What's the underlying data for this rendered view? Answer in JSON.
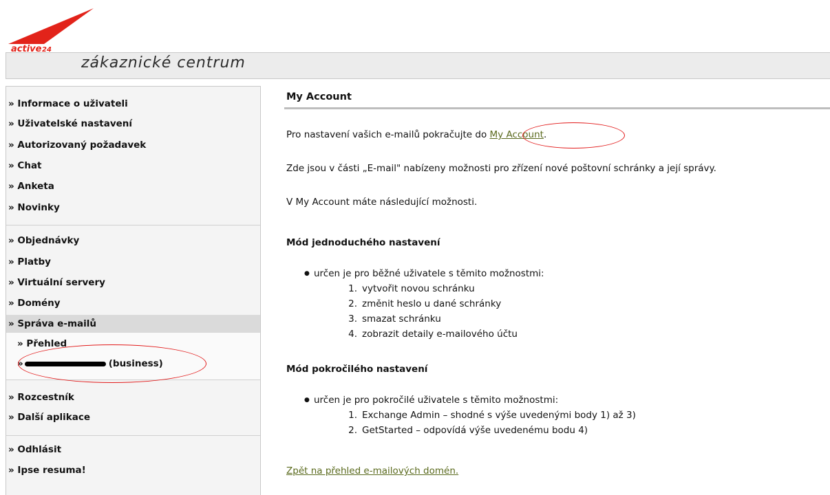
{
  "brand": {
    "logo_text": "active",
    "logo_number": "24",
    "subtitle": "zákaznické centrum",
    "accent": "#e2231a"
  },
  "sidebar": {
    "groups": [
      [
        "» Informace o uživateli",
        "» Uživatelské nastavení",
        "» Autorizovaný požadavek",
        "» Chat",
        "» Anketa",
        "» Novinky"
      ],
      [
        "» Objednávky",
        "» Platby",
        "» Virtuální servery",
        "» Domény",
        "» Správa e-mailů"
      ],
      [
        "» Rozcestník",
        "» Další aplikace"
      ],
      [
        "» Odhlásit",
        "» Ipse resuma!"
      ]
    ],
    "submenu": {
      "overview": "» Přehled",
      "domain_prefix": "»",
      "domain_suffix": "(business)"
    }
  },
  "content": {
    "title": "My Account",
    "intro_prefix": "Pro nastavení vašich e-mailů pokračujte do ",
    "intro_link": "My Account",
    "intro_suffix": ".",
    "p2": "Zde jsou v části „E-mail\" nabízeny možnosti pro zřízení nové poštovní schránky a její správy.",
    "p3": "V My Account máte následující možnosti.",
    "section1": {
      "heading": "Mód jednoduchého nastavení",
      "bullet": "určen je pro běžné uživatele s těmito možnostmi:",
      "items": [
        "vytvořit novou schránku",
        "změnit heslo u dané schránky",
        "smazat schránku",
        "zobrazit detaily e-mailového účtu"
      ]
    },
    "section2": {
      "heading": "Mód pokročilého nastavení",
      "bullet": "určen je pro pokročilé uživatele s těmito možnostmi:",
      "items": [
        "Exchange Admin – shodné s výše uvedenými body 1) až 3)",
        "GetStarted – odpovídá výše uvedenému bodu 4)"
      ]
    },
    "back_link": "Zpět na přehled e-mailových domén."
  },
  "colors": {
    "link": "#5a6a1d",
    "annotation": "#e21a1a",
    "sidebar_bg": "#f4f4f4",
    "header_bg": "#ececec"
  }
}
